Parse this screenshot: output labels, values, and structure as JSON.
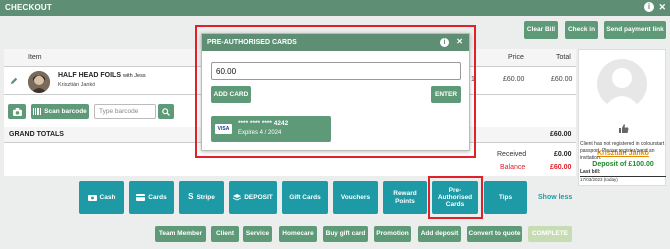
{
  "window": {
    "title": "CHECKOUT",
    "info_icon": "i",
    "close_icon": "✕"
  },
  "top_buttons": {
    "clear_bill": "Clear Bill",
    "check_in": "Check in",
    "send_payment_link": "Send payment link"
  },
  "table": {
    "headers": {
      "item": "Item",
      "price": "Price",
      "total": "Total"
    },
    "row": {
      "name": "HALF HEAD FOILS",
      "with": "with Jess",
      "stylist": "Krisztián Jankó",
      "qty_fragment": "1",
      "price": "£60.00",
      "total": "£60.00"
    }
  },
  "tools": {
    "scan_barcode": "Scan barcode",
    "type_barcode_placeholder": "Type barcode"
  },
  "totals": {
    "grand_totals_label": "GRAND TOTALS",
    "grand_totals_value": "£60.00",
    "received_label": "Received",
    "received_value": "£0.00",
    "balance_label": "Balance",
    "balance_value": "£60.00",
    "balance_color": "#e0202a"
  },
  "payment_buttons": {
    "cash": "Cash",
    "cards": "Cards",
    "stripe": "Stripe",
    "deposit": "DEPOSIT",
    "gift_cards": "Gift Cards",
    "vouchers": "Vouchers",
    "reward_points": "Reward Points",
    "pre_authorised": "Pre-Authorised Cards",
    "tips": "Tips",
    "show_less": "Show less"
  },
  "action_buttons": {
    "team_member": "Team Member",
    "client": "Client",
    "service": "Service",
    "homecare": "Homecare",
    "buy_gift_card": "Buy gift card",
    "promotion": "Promotion",
    "add_deposit": "Add deposit",
    "convert_to_quote": "Convert to quote",
    "complete": "COMPLETE"
  },
  "customer": {
    "name": "Krisztián Jankó",
    "deposit": "Deposit of £100.00",
    "note": "Client has not registered in colourstart passport, Please register/send an invitation.",
    "last_bill_label": "Last bill:",
    "last_bill_value": "17/03/2023 (today)"
  },
  "modal": {
    "title": "PRE-AUTHORISED CARDS",
    "amount_value": "60.00",
    "add_card": "ADD CARD",
    "enter": "ENTER",
    "card_brand": "VISA",
    "card_number": "**** **** **** 4242",
    "card_expiry": "Expires 4 / 2024"
  },
  "colors": {
    "brand_green": "#5e8f74",
    "teal": "#1d9aa6",
    "highlight_red": "#e0202a"
  }
}
